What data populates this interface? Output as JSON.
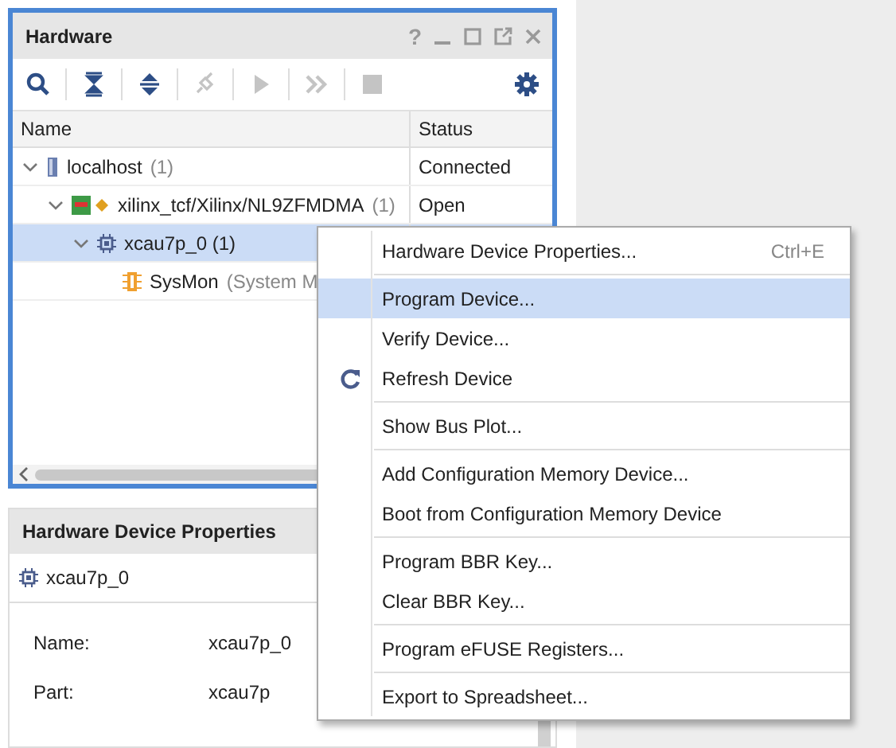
{
  "hardware_panel": {
    "title": "Hardware",
    "help": "?",
    "toolbar": [
      {
        "kind": "search",
        "disabled": false
      },
      {
        "kind": "collapse",
        "disabled": false
      },
      {
        "kind": "expand",
        "disabled": false
      },
      {
        "kind": "connect",
        "disabled": true
      },
      {
        "kind": "run",
        "disabled": true
      },
      {
        "kind": "skip",
        "disabled": true
      },
      {
        "kind": "stop",
        "disabled": true
      },
      {
        "kind": "settings",
        "disabled": false
      }
    ],
    "columns": [
      "Name",
      "Status"
    ],
    "tree": [
      {
        "kind": "host",
        "label": "localhost",
        "count": "(1)",
        "status": "Connected",
        "selected": false,
        "expanded": true,
        "children": [
          {
            "kind": "cable",
            "label": "xilinx_tcf/Xilinx/NL9ZFMDMA",
            "count": "(1)",
            "status": "Open",
            "selected": false,
            "expanded": true,
            "children": [
              {
                "kind": "chip",
                "label": "xcau7p_0 (1)",
                "selected": true,
                "expanded": true,
                "children": [
                  {
                    "kind": "sysmon",
                    "label": "SysMon",
                    "count": "(System M",
                    "selected": false
                  }
                ]
              }
            ]
          }
        ]
      }
    ]
  },
  "properties_panel": {
    "title": "Hardware Device Properties",
    "device": "xcau7p_0",
    "rows": [
      {
        "label": "Name:",
        "value": "xcau7p_0"
      },
      {
        "label": "Part:",
        "value": "xcau7p"
      }
    ]
  },
  "context_menu": {
    "groups": [
      [
        {
          "label": "Hardware Device Properties...",
          "shortcut": "Ctrl+E",
          "selected": false,
          "icon": false
        }
      ],
      [
        {
          "label": "Program Device...",
          "selected": true,
          "icon": false
        },
        {
          "label": "Verify Device...",
          "selected": false,
          "icon": false
        },
        {
          "label": "Refresh Device",
          "selected": false,
          "icon": true
        }
      ],
      [
        {
          "label": "Show Bus Plot...",
          "selected": false,
          "icon": false
        }
      ],
      [
        {
          "label": "Add Configuration Memory Device...",
          "selected": false,
          "icon": false
        },
        {
          "label": "Boot from Configuration Memory Device",
          "selected": false,
          "icon": false
        }
      ],
      [
        {
          "label": "Program BBR Key...",
          "selected": false,
          "icon": false
        },
        {
          "label": "Clear BBR Key...",
          "selected": false,
          "icon": false
        }
      ],
      [
        {
          "label": "Program eFUSE Registers...",
          "selected": false,
          "icon": false
        }
      ],
      [
        {
          "label": "Export to Spreadsheet...",
          "selected": false,
          "icon": false
        }
      ]
    ]
  }
}
